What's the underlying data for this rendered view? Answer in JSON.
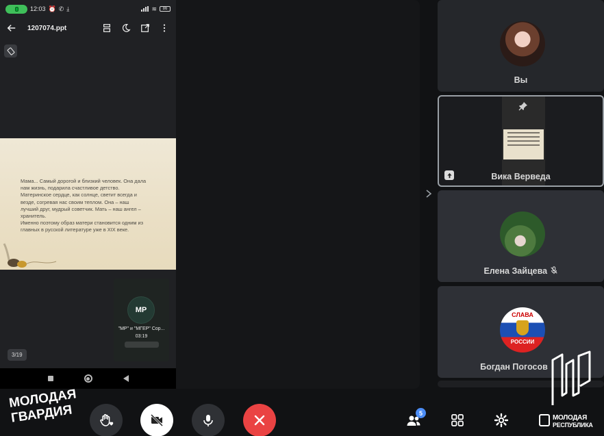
{
  "status_bar": {
    "time": "12:03",
    "battery": "86"
  },
  "doc_viewer": {
    "file_name": "1207074.ppt",
    "page_indicator": "3/19",
    "slide_lines": [
      "Мама... Самый дорогой и близкий человек. Она дала",
      "нам жизнь, подарила счастливое детство.",
      "Материнское сердце, как солнце, светит всегда и",
      "везде, согревая нас своим теплом. Она – наш",
      "лучший друг, мудрый советчик. Мать – наш ангел –",
      "хранитель.",
      "Именно поэтому образ матери становится одним из",
      "главных в русской литературе уже в XIX веке."
    ],
    "video_call": {
      "logo_text": "МР",
      "caption": "\"МР\" и \"МГЕР\" Сор...",
      "duration": "03:19"
    }
  },
  "participants": [
    {
      "name": "Вы"
    },
    {
      "name": "Вика Верведа"
    },
    {
      "name": "Елена Зайцева"
    },
    {
      "name": "Богдан Погосов"
    }
  ],
  "avatar_flag": {
    "top_text": "СЛАВА",
    "bottom_text": "РОССИИ"
  },
  "controls": {
    "participants_count": "5"
  },
  "branding": {
    "left_line1": "МОЛОДАЯ",
    "left_line2": "ГВАРДИЯ",
    "right_mark": "МР",
    "right_line1": "МОЛОДАЯ",
    "right_line2": "РЕСПУБЛИКА"
  },
  "colors": {
    "hangup": "#ea4343",
    "badge": "#4c8df6",
    "call_pill": "#3fbf5a"
  }
}
